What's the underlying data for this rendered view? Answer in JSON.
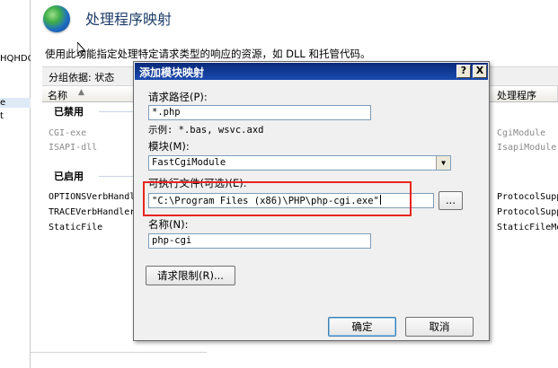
{
  "page": {
    "title": "处理程序映射",
    "description": "使用此功能指定处理特定请求类型的响应的资源，如 DLL 和托管代码。"
  },
  "left_tree": {
    "fragment_1": "HQHDOU",
    "fragment_2": "e",
    "fragment_3": "t"
  },
  "group_bar": {
    "label": "分组依据:  状态"
  },
  "table": {
    "headers": {
      "name": "名称",
      "handler": "处理程序"
    },
    "disabled_group": "已禁用",
    "enabled_group": "已启用",
    "disabled_rows": [
      {
        "name": "CGI-exe",
        "handler": "CgiModule"
      },
      {
        "name": "ISAPI-dll",
        "handler": "IsapiModule"
      }
    ],
    "enabled_rows": [
      {
        "name": "OPTIONSVerbHandler",
        "handler": "ProtocolSupportModule"
      },
      {
        "name": "TRACEVerbHandler",
        "handler": "ProtocolSupportModule"
      },
      {
        "name": "StaticFile",
        "handler": "StaticFileModule"
      }
    ]
  },
  "dialog": {
    "title": "添加模块映射",
    "help_button": "?",
    "close_button": "X",
    "request_path_label": "请求路径(P):",
    "request_path_value": "*.php",
    "example_text": "示例: *.bas, wsvc.axd",
    "module_label": "模块(M):",
    "module_value": "FastCgiModule",
    "executable_label": "可执行文件(可选)(E):",
    "executable_value": "\"C:\\Program Files (x86)\\PHP\\php-cgi.exe\"",
    "browse_button": "...",
    "name_label": "名称(N):",
    "name_value": "php-cgi",
    "request_restrictions_button": "请求限制(R)...",
    "ok_button": "确定",
    "cancel_button": "取消"
  },
  "colors": {
    "title_blue": "#1e3e6a",
    "titlebar": "#0a2a7a",
    "highlight_red": "#e8251f"
  }
}
